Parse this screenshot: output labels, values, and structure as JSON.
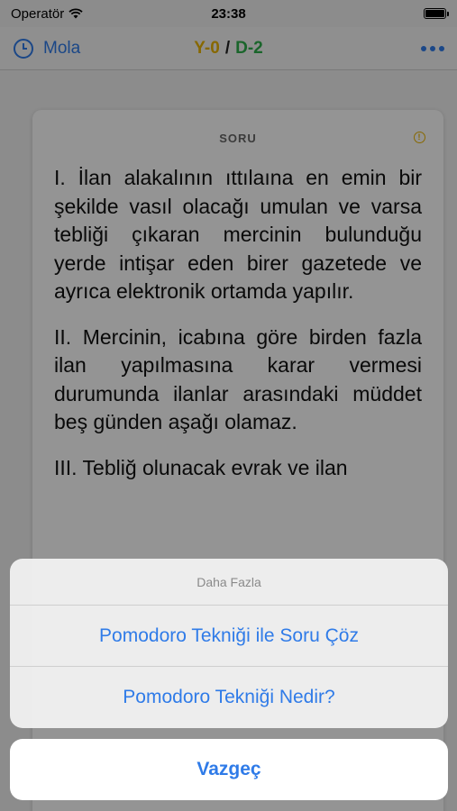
{
  "status": {
    "carrier": "Operatör",
    "time": "23:38"
  },
  "nav": {
    "mola_label": "Mola",
    "score_y": "Y-0",
    "score_sep": "/",
    "score_d": "D-2"
  },
  "card": {
    "header": "SORU",
    "paragraphs": [
      "I. İlan alakalının ıttılaına en emin bir şekilde vasıl olacağı umulan ve varsa tebliği çıkaran mercinin bulunduğu yerde intişar eden birer gazetede ve ayrıca elektronik ortamda yapılır.",
      "II. Mercinin, icabına göre birden fazla ilan yapılmasına karar vermesi durumunda ilanlar arasındaki müddet beş günden aşağı olamaz.",
      "III. Tebliğ olunacak evrak ve ilan"
    ]
  },
  "sheet": {
    "title": "Daha Fazla",
    "actions": [
      "Pomodoro Tekniği ile Soru Çöz",
      "Pomodoro Tekniği Nedir?"
    ],
    "cancel": "Vazgeç"
  },
  "colors": {
    "accent": "#2f7be8",
    "yellow": "#e9b400",
    "green": "#2eaf4a"
  },
  "icons": {
    "clock": "clock-icon",
    "more": "more-icon",
    "info": "info-icon",
    "wifi": "wifi-icon",
    "battery": "battery-icon"
  }
}
